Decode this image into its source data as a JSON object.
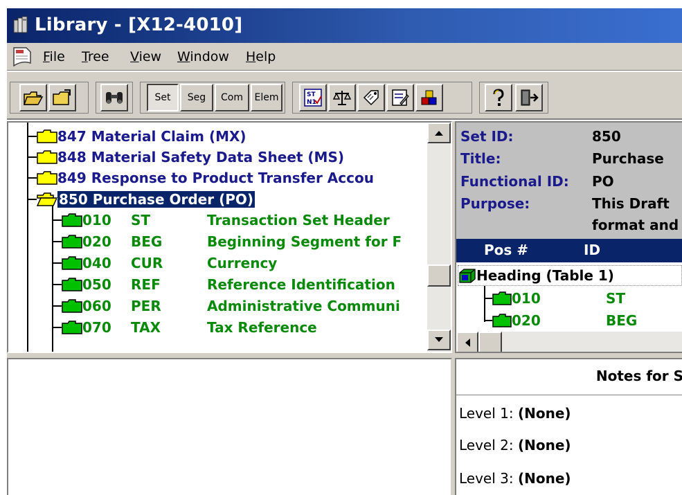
{
  "window": {
    "title": "Library - [X12-4010]"
  },
  "menu": {
    "items": [
      "File",
      "Tree",
      "View",
      "Window",
      "Help"
    ]
  },
  "toolbar": {
    "open_icon": "open-folder-icon",
    "close_icon": "folder-up-icon",
    "find_icon": "binoculars-icon",
    "toggle_labels": [
      "Set",
      "Seg",
      "Com",
      "Elem"
    ],
    "active_toggle": "Set",
    "tool_icons": [
      "st-n1-icon",
      "scale-icon",
      "tag-icon",
      "edit-icon",
      "blocks-icon",
      "help-icon",
      "exit-icon"
    ]
  },
  "tree": {
    "items": [
      {
        "label": "847 Material Claim (MX)",
        "color": "#1a1a8c"
      },
      {
        "label": "848 Material Safety Data Sheet (MS)",
        "color": "#1a1a8c"
      },
      {
        "label": "849 Response to Product Transfer Accou",
        "color": "#1a1a8c"
      },
      {
        "label": "850 Purchase Order (PO)",
        "color": "#1a1a8c",
        "selected": true
      }
    ],
    "segments": [
      {
        "pos": "010",
        "id": "ST",
        "name": "Transaction Set Header"
      },
      {
        "pos": "020",
        "id": "BEG",
        "name": "Beginning Segment for F"
      },
      {
        "pos": "040",
        "id": "CUR",
        "name": "Currency"
      },
      {
        "pos": "050",
        "id": "REF",
        "name": "Reference Identification"
      },
      {
        "pos": "060",
        "id": "PER",
        "name": "Administrative Communi"
      },
      {
        "pos": "070",
        "id": "TAX",
        "name": "Tax Reference"
      }
    ]
  },
  "info": {
    "set_id_key": "Set ID:",
    "set_id_val": "850",
    "title_key": "Title:",
    "title_val": "Purchase",
    "func_key": "Functional ID:",
    "func_val": "PO",
    "purpose_key": "Purpose:",
    "purpose_val": "This Draft",
    "purpose_val2": "format and"
  },
  "grid": {
    "col_pos": "Pos #",
    "col_id": "ID",
    "heading": "Heading (Table 1)",
    "rows": [
      {
        "pos": "010",
        "id": "ST"
      },
      {
        "pos": "020",
        "id": "BEG"
      }
    ]
  },
  "notes": {
    "title": "Notes for S",
    "rows": [
      {
        "label": "Level 1:",
        "value": "(None)"
      },
      {
        "label": "Level 2:",
        "value": "(None)"
      },
      {
        "label": "Level 3:",
        "value": "(None)"
      }
    ]
  }
}
